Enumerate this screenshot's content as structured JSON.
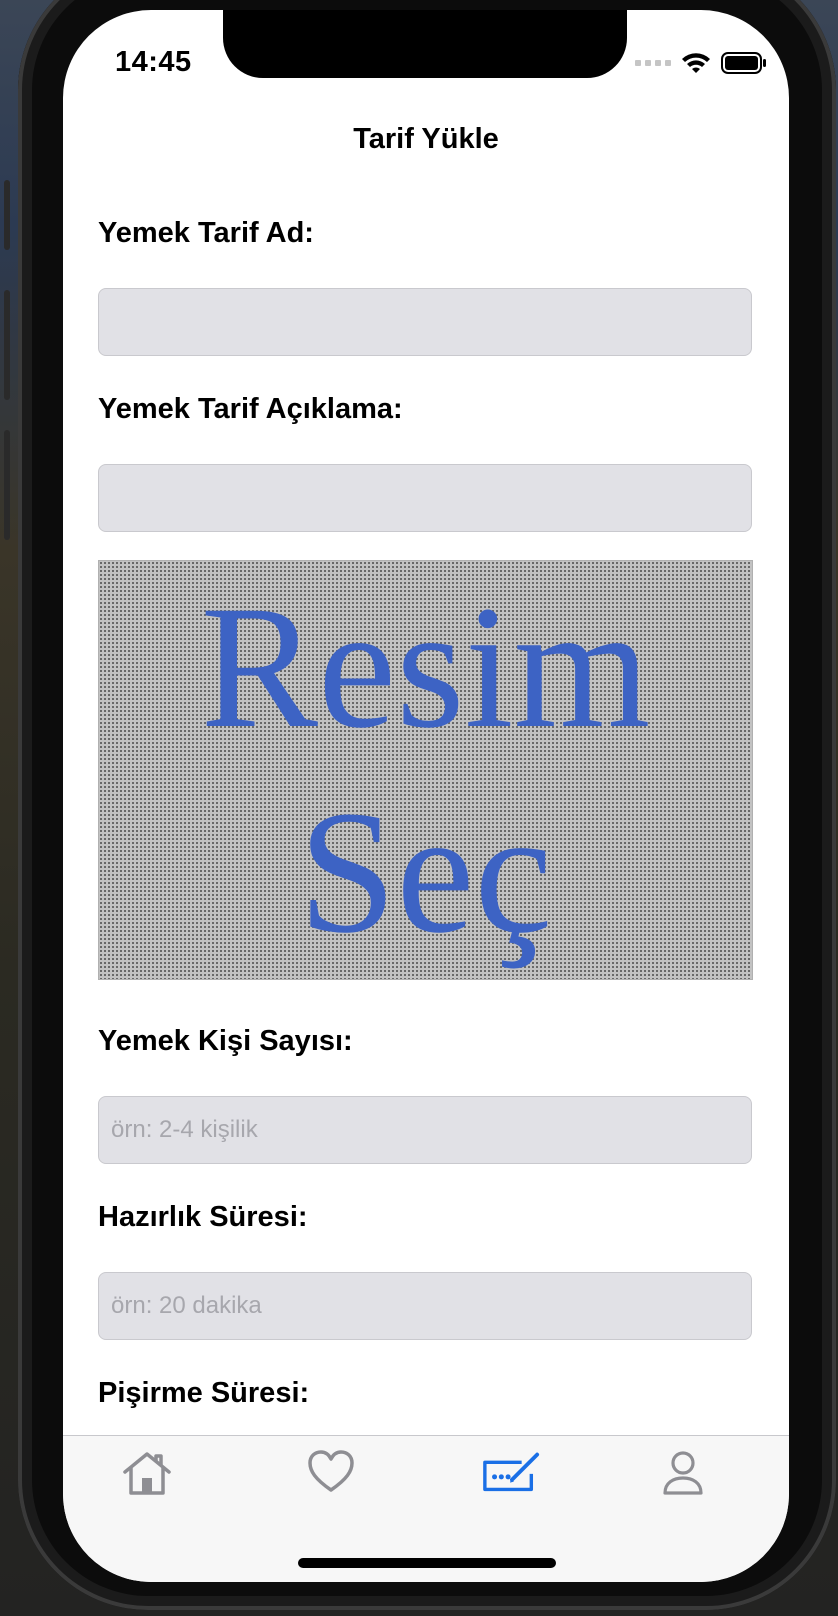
{
  "status_bar": {
    "time": "14:45"
  },
  "nav": {
    "title": "Tarif Yükle"
  },
  "form": {
    "recipe_name_label": "Yemek Tarif Ad:",
    "recipe_name_value": "",
    "recipe_desc_label": "Yemek Tarif Açıklama:",
    "recipe_desc_value": "",
    "image_picker_line1": "Resim",
    "image_picker_line2": "Seç",
    "servings_label": "Yemek Kişi Sayısı:",
    "servings_placeholder": "örn: 2-4 kişilik",
    "prep_time_label": "Hazırlık Süresi:",
    "prep_time_placeholder": "örn: 20 dakika",
    "cook_time_label": "Pişirme Süresi:"
  },
  "tab_bar": {
    "items": [
      {
        "icon": "home-icon",
        "selected": false
      },
      {
        "icon": "heart-icon",
        "selected": false
      },
      {
        "icon": "upload-recipe-icon",
        "selected": true
      },
      {
        "icon": "person-icon",
        "selected": false
      }
    ],
    "active_color": "#1a6fe6",
    "inactive_color": "#8e8e93"
  }
}
